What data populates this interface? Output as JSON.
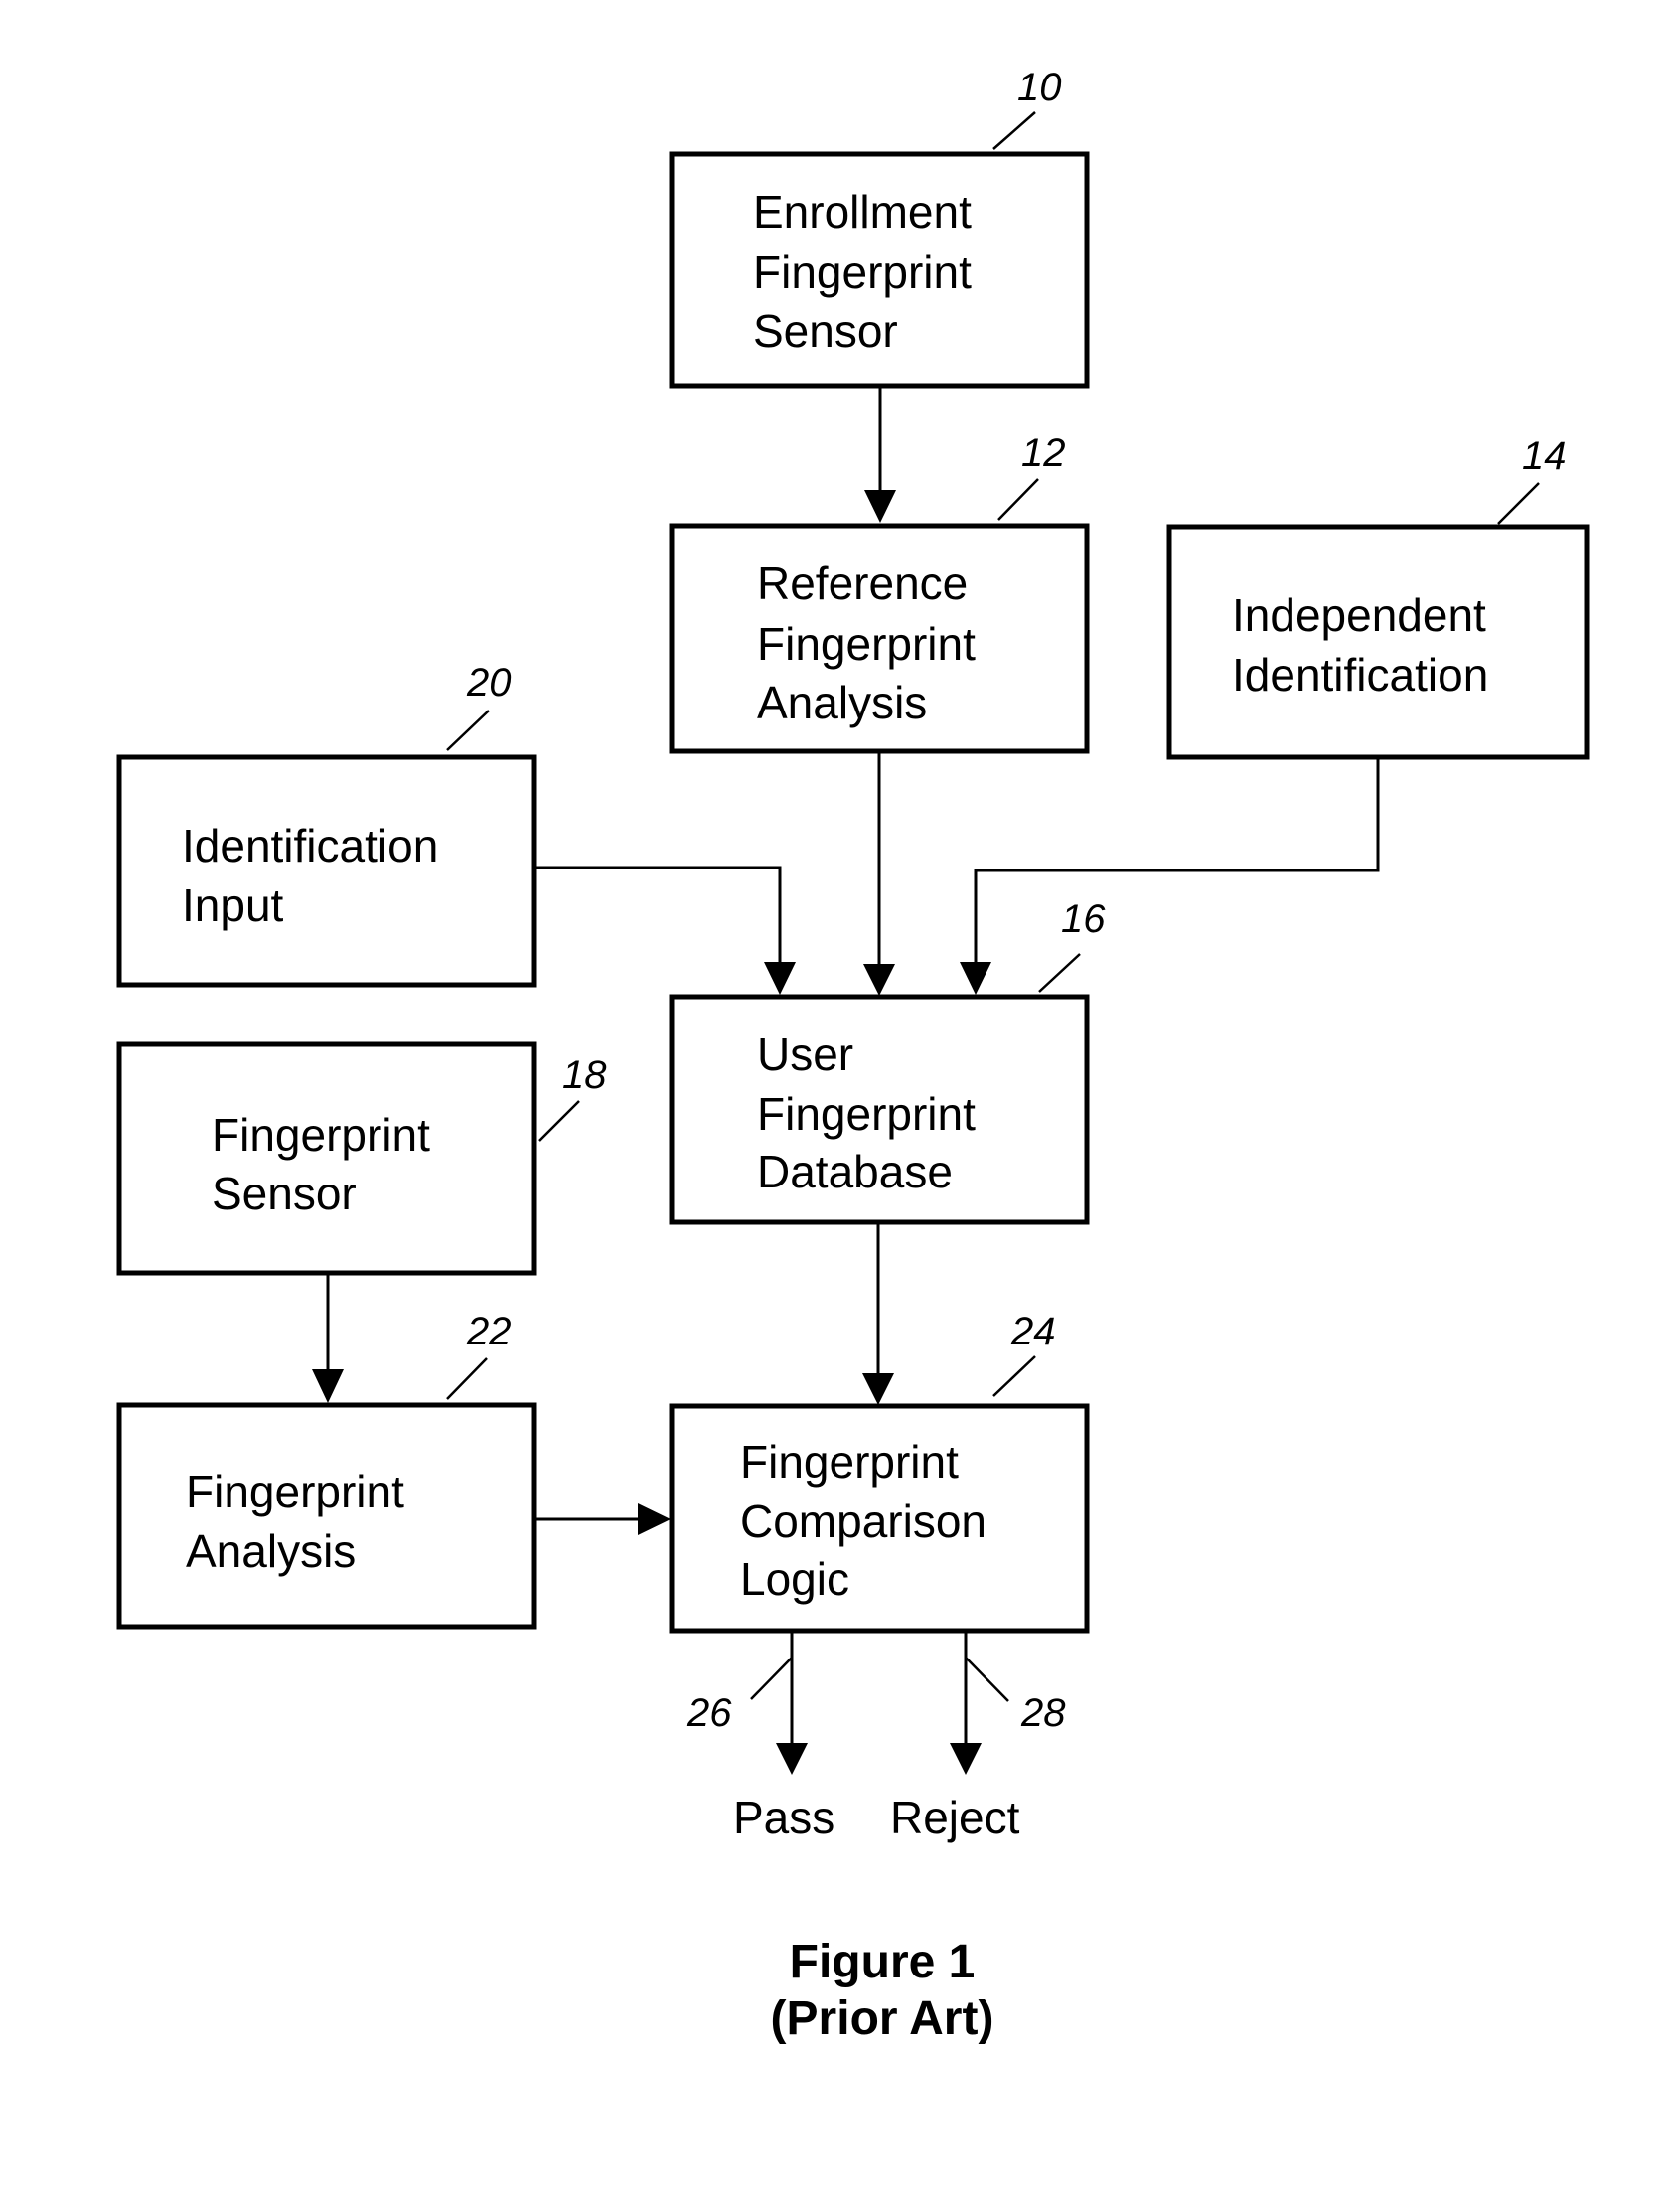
{
  "figure": {
    "title": "Figure 1",
    "subtitle": "(Prior Art)"
  },
  "blocks": [
    {
      "ref": "10",
      "lines": [
        "Enrollment",
        "Fingerprint",
        "Sensor"
      ]
    },
    {
      "ref": "12",
      "lines": [
        "Reference",
        "Fingerprint",
        "Analysis"
      ]
    },
    {
      "ref": "14",
      "lines": [
        "Independent",
        "Identification"
      ]
    },
    {
      "ref": "20",
      "lines": [
        "Identification",
        "Input"
      ]
    },
    {
      "ref": "16",
      "lines": [
        "User",
        "Fingerprint",
        "Database"
      ]
    },
    {
      "ref": "18",
      "lines": [
        "Fingerprint",
        "Sensor"
      ]
    },
    {
      "ref": "22",
      "lines": [
        "Fingerprint",
        "Analysis"
      ]
    },
    {
      "ref": "24",
      "lines": [
        "Fingerprint",
        "Comparison",
        "Logic"
      ]
    }
  ],
  "outputs": [
    {
      "ref": "26",
      "label": "Pass"
    },
    {
      "ref": "28",
      "label": "Reject"
    }
  ],
  "connections": [
    {
      "from": "10",
      "to": "12"
    },
    {
      "from": "12",
      "to": "16"
    },
    {
      "from": "14",
      "to": "16"
    },
    {
      "from": "20",
      "to": "16"
    },
    {
      "from": "16",
      "to": "24"
    },
    {
      "from": "18",
      "to": "22"
    },
    {
      "from": "22",
      "to": "24"
    },
    {
      "from": "24",
      "to": "Pass"
    },
    {
      "from": "24",
      "to": "Reject"
    }
  ]
}
